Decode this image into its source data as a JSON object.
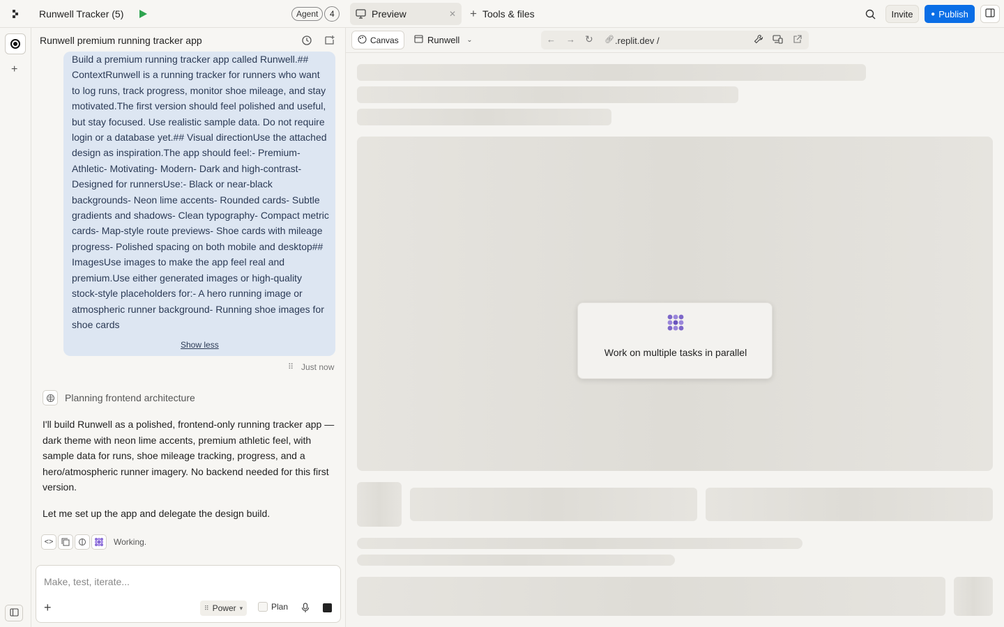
{
  "app": {
    "project_title": "Runwell Tracker (5)",
    "agent_label": "Agent",
    "agent_count": "4"
  },
  "tabs": {
    "preview_label": "Preview",
    "tools_label": "Tools & files"
  },
  "header_right": {
    "invite_label": "Invite",
    "publish_label": "Publish"
  },
  "chat": {
    "title": "Runwell premium running tracker app",
    "user_message": "Build a premium running tracker app called Runwell.## ContextRunwell is a running tracker for runners who want to log runs, track progress, monitor shoe mileage, and stay motivated.The first version should feel polished and useful, but stay focused. Use realistic sample data. Do not require login or a database yet.## Visual directionUse the attached design as inspiration.The app should feel:- Premium- Athletic- Motivating- Modern- Dark and high-contrast- Designed for runnersUse:- Black or near-black backgrounds- Neon lime accents- Rounded cards- Subtle gradients and shadows- Clean typography- Compact metric cards- Map-style route previews- Shoe cards with mileage progress- Polished spacing on both mobile and desktop## ImagesUse images to make the app feel real and premium.Use either generated images or high-quality stock-style placeholders for:- A hero running image or atmospheric runner background- Running shoe images for shoe cards",
    "show_less": "Show less",
    "timestamp": "Just now",
    "thinking_label": "Planning frontend architecture",
    "reply_p1": "I'll build Runwell as a polished, frontend-only running tracker app — dark theme with neon lime accents, premium athletic feel, with sample data for runs, shoe mileage tracking, progress, and a hero/atmospheric runner imagery. No backend needed for this first version.",
    "reply_p2": "Let me set up the app and delegate the design build.",
    "status": "Working.",
    "input_placeholder": "Make, test, iterate...",
    "power_label": "Power",
    "plan_label": "Plan"
  },
  "preview_toolbar": {
    "canvas_label": "Canvas",
    "app_select": "Runwell",
    "url": ".replit.dev /"
  },
  "preview_card": {
    "text": "Work on multiple tasks in parallel"
  },
  "colors": {
    "accent": "#0a6ee6",
    "user_bubble": "#dde6f2",
    "run_green": "#2ea44f"
  }
}
